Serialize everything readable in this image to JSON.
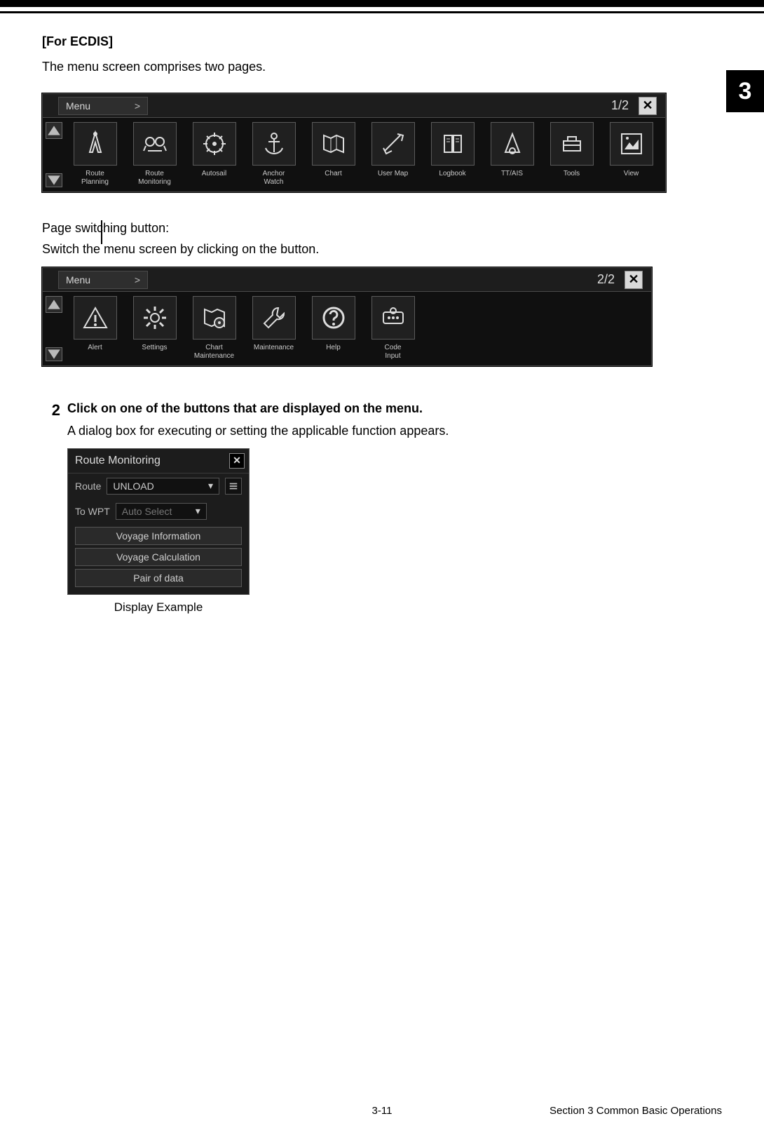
{
  "heading_ecdis": "[For ECDIS]",
  "intro": "The menu screen comprises two pages.",
  "side_tab": "3",
  "menu_label": "Menu",
  "chev": ">",
  "page1_ind": "1/2",
  "page2_ind": "2/2",
  "close": "✕",
  "menu_page1": [
    {
      "label": "Route\nPlanning"
    },
    {
      "label": "Route\nMonitoring"
    },
    {
      "label": "Autosail"
    },
    {
      "label": "Anchor\nWatch"
    },
    {
      "label": "Chart"
    },
    {
      "label": "User Map"
    },
    {
      "label": "Logbook"
    },
    {
      "label": "TT/AIS"
    },
    {
      "label": "Tools"
    },
    {
      "label": "View"
    }
  ],
  "page_switch_heading": "Page switching button:",
  "page_switch_body": "Switch the menu screen by clicking on the button.",
  "menu_page2": [
    {
      "label": "Alert"
    },
    {
      "label": "Settings"
    },
    {
      "label": "Chart\nMaintenance"
    },
    {
      "label": "Maintenance"
    },
    {
      "label": "Help"
    },
    {
      "label": "Code\nInput"
    }
  ],
  "step2_num": "2",
  "step2_title": "Click on one of the buttons that are displayed on the menu.",
  "step2_body": "A dialog box for executing or setting the applicable function appears.",
  "dialog": {
    "title": "Route Monitoring",
    "route_label": "Route",
    "route_value": "UNLOAD",
    "wpt_label": "To WPT",
    "wpt_value": "Auto Select",
    "btn1": "Voyage Information",
    "btn2": "Voyage Calculation",
    "btn3": "Pair of data",
    "caption": "Display Example"
  },
  "footer_page": "3-11",
  "footer_section": "Section 3    Common Basic Operations"
}
